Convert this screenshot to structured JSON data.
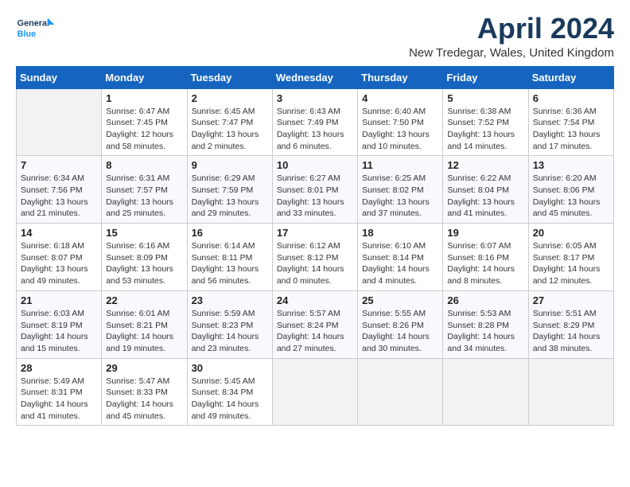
{
  "header": {
    "logo_line1": "General",
    "logo_line2": "Blue",
    "title": "April 2024",
    "subtitle": "New Tredegar, Wales, United Kingdom"
  },
  "columns": [
    "Sunday",
    "Monday",
    "Tuesday",
    "Wednesday",
    "Thursday",
    "Friday",
    "Saturday"
  ],
  "weeks": [
    [
      {
        "day": "",
        "info": ""
      },
      {
        "day": "1",
        "info": "Sunrise: 6:47 AM\nSunset: 7:45 PM\nDaylight: 12 hours\nand 58 minutes."
      },
      {
        "day": "2",
        "info": "Sunrise: 6:45 AM\nSunset: 7:47 PM\nDaylight: 13 hours\nand 2 minutes."
      },
      {
        "day": "3",
        "info": "Sunrise: 6:43 AM\nSunset: 7:49 PM\nDaylight: 13 hours\nand 6 minutes."
      },
      {
        "day": "4",
        "info": "Sunrise: 6:40 AM\nSunset: 7:50 PM\nDaylight: 13 hours\nand 10 minutes."
      },
      {
        "day": "5",
        "info": "Sunrise: 6:38 AM\nSunset: 7:52 PM\nDaylight: 13 hours\nand 14 minutes."
      },
      {
        "day": "6",
        "info": "Sunrise: 6:36 AM\nSunset: 7:54 PM\nDaylight: 13 hours\nand 17 minutes."
      }
    ],
    [
      {
        "day": "7",
        "info": "Sunrise: 6:34 AM\nSunset: 7:56 PM\nDaylight: 13 hours\nand 21 minutes."
      },
      {
        "day": "8",
        "info": "Sunrise: 6:31 AM\nSunset: 7:57 PM\nDaylight: 13 hours\nand 25 minutes."
      },
      {
        "day": "9",
        "info": "Sunrise: 6:29 AM\nSunset: 7:59 PM\nDaylight: 13 hours\nand 29 minutes."
      },
      {
        "day": "10",
        "info": "Sunrise: 6:27 AM\nSunset: 8:01 PM\nDaylight: 13 hours\nand 33 minutes."
      },
      {
        "day": "11",
        "info": "Sunrise: 6:25 AM\nSunset: 8:02 PM\nDaylight: 13 hours\nand 37 minutes."
      },
      {
        "day": "12",
        "info": "Sunrise: 6:22 AM\nSunset: 8:04 PM\nDaylight: 13 hours\nand 41 minutes."
      },
      {
        "day": "13",
        "info": "Sunrise: 6:20 AM\nSunset: 8:06 PM\nDaylight: 13 hours\nand 45 minutes."
      }
    ],
    [
      {
        "day": "14",
        "info": "Sunrise: 6:18 AM\nSunset: 8:07 PM\nDaylight: 13 hours\nand 49 minutes."
      },
      {
        "day": "15",
        "info": "Sunrise: 6:16 AM\nSunset: 8:09 PM\nDaylight: 13 hours\nand 53 minutes."
      },
      {
        "day": "16",
        "info": "Sunrise: 6:14 AM\nSunset: 8:11 PM\nDaylight: 13 hours\nand 56 minutes."
      },
      {
        "day": "17",
        "info": "Sunrise: 6:12 AM\nSunset: 8:12 PM\nDaylight: 14 hours\nand 0 minutes."
      },
      {
        "day": "18",
        "info": "Sunrise: 6:10 AM\nSunset: 8:14 PM\nDaylight: 14 hours\nand 4 minutes."
      },
      {
        "day": "19",
        "info": "Sunrise: 6:07 AM\nSunset: 8:16 PM\nDaylight: 14 hours\nand 8 minutes."
      },
      {
        "day": "20",
        "info": "Sunrise: 6:05 AM\nSunset: 8:17 PM\nDaylight: 14 hours\nand 12 minutes."
      }
    ],
    [
      {
        "day": "21",
        "info": "Sunrise: 6:03 AM\nSunset: 8:19 PM\nDaylight: 14 hours\nand 15 minutes."
      },
      {
        "day": "22",
        "info": "Sunrise: 6:01 AM\nSunset: 8:21 PM\nDaylight: 14 hours\nand 19 minutes."
      },
      {
        "day": "23",
        "info": "Sunrise: 5:59 AM\nSunset: 8:23 PM\nDaylight: 14 hours\nand 23 minutes."
      },
      {
        "day": "24",
        "info": "Sunrise: 5:57 AM\nSunset: 8:24 PM\nDaylight: 14 hours\nand 27 minutes."
      },
      {
        "day": "25",
        "info": "Sunrise: 5:55 AM\nSunset: 8:26 PM\nDaylight: 14 hours\nand 30 minutes."
      },
      {
        "day": "26",
        "info": "Sunrise: 5:53 AM\nSunset: 8:28 PM\nDaylight: 14 hours\nand 34 minutes."
      },
      {
        "day": "27",
        "info": "Sunrise: 5:51 AM\nSunset: 8:29 PM\nDaylight: 14 hours\nand 38 minutes."
      }
    ],
    [
      {
        "day": "28",
        "info": "Sunrise: 5:49 AM\nSunset: 8:31 PM\nDaylight: 14 hours\nand 41 minutes."
      },
      {
        "day": "29",
        "info": "Sunrise: 5:47 AM\nSunset: 8:33 PM\nDaylight: 14 hours\nand 45 minutes."
      },
      {
        "day": "30",
        "info": "Sunrise: 5:45 AM\nSunset: 8:34 PM\nDaylight: 14 hours\nand 49 minutes."
      },
      {
        "day": "",
        "info": ""
      },
      {
        "day": "",
        "info": ""
      },
      {
        "day": "",
        "info": ""
      },
      {
        "day": "",
        "info": ""
      }
    ]
  ]
}
